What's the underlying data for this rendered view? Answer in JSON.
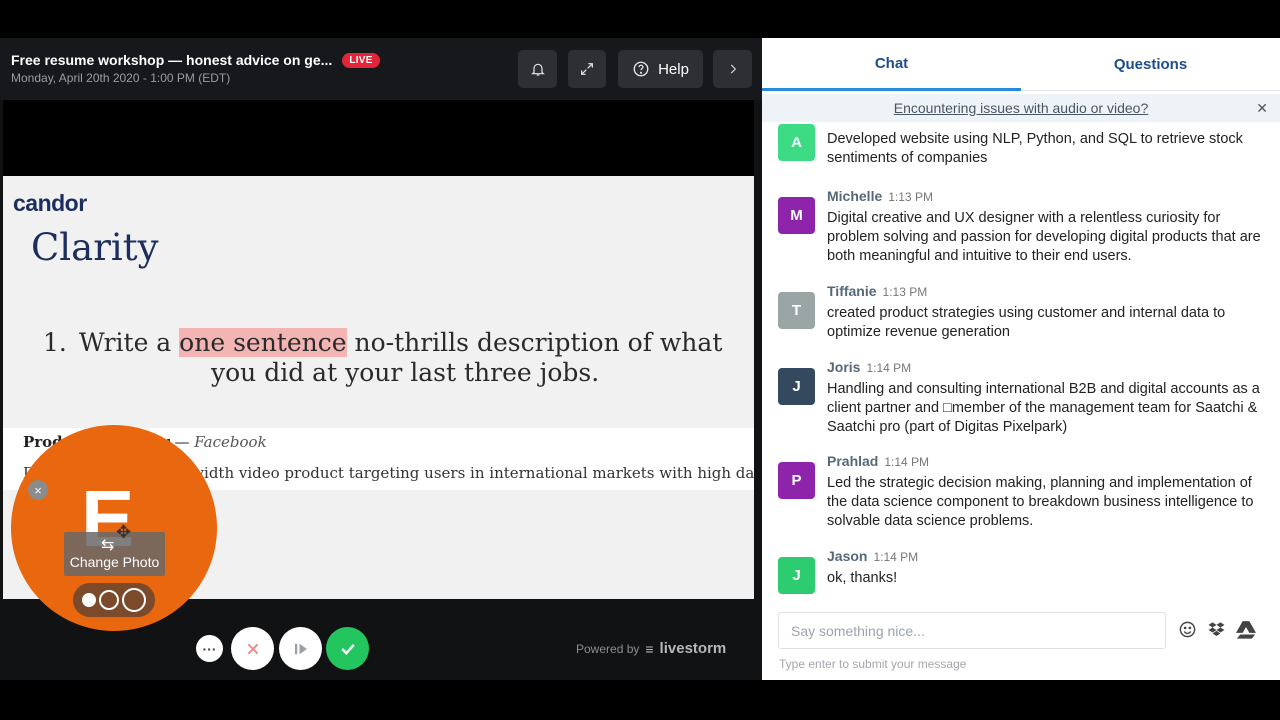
{
  "header": {
    "title": "Free resume workshop — honest advice on ge...",
    "live_label": "LIVE",
    "date": "Monday, April 20th 2020 - 1:00 PM (EDT)",
    "help_label": "Help"
  },
  "slide": {
    "logo": "candor",
    "heading": "Clarity",
    "point_number": "1.",
    "point_pre": "Write a ",
    "point_highlight": "one sentence",
    "point_post": " no-thrills description of what",
    "point_line2": "you did at your last three jobs.",
    "example_role": "Product Manager",
    "example_sep": " — ",
    "example_company": "Facebook",
    "example_desc": "Developed a low-bandwidth video product targeting users in international markets with high data costs"
  },
  "webcam": {
    "letter": "E",
    "change_photo_label": "Change Photo"
  },
  "footer": {
    "powered_by": "Powered by",
    "brand": "livestorm"
  },
  "panel": {
    "tabs": [
      "Chat",
      "Questions"
    ],
    "notice": "Encountering issues with audio or video?",
    "input_placeholder": "Say something nice...",
    "hint": "Type enter to submit your message"
  },
  "messages": [
    {
      "initial": "A",
      "color": "#3ddc84",
      "name": "",
      "time": "",
      "text": "Developed website using NLP, Python, and SQL to retrieve stock sentiments of companies"
    },
    {
      "initial": "M",
      "color": "#8e24aa",
      "name": "Michelle",
      "time": "1:13 PM",
      "text": "Digital creative and UX designer with a relentless curiosity for problem solving and passion for developing digital products that are both meaningful and intuitive to their end users."
    },
    {
      "initial": "T",
      "color": "#9aa5a6",
      "name": "Tiffanie",
      "time": "1:13 PM",
      "text": "created product strategies using customer and internal data to optimize revenue generation"
    },
    {
      "initial": "J",
      "color": "#34495e",
      "name": "Joris",
      "time": "1:14 PM",
      "text": "Handling and consulting international B2B and digital accounts as a client partner and □member of the management team for Saatchi & Saatchi pro (part of Digitas Pixelpark)"
    },
    {
      "initial": "P",
      "color": "#8e24aa",
      "name": "Prahlad",
      "time": "1:14 PM",
      "text": "Led the strategic decision making, planning and implementation of the data science component to breakdown business intelligence to solvable data science problems."
    },
    {
      "initial": "J",
      "color": "#2ecc71",
      "name": "Jason",
      "time": "1:14 PM",
      "text": "ok, thanks!"
    }
  ]
}
